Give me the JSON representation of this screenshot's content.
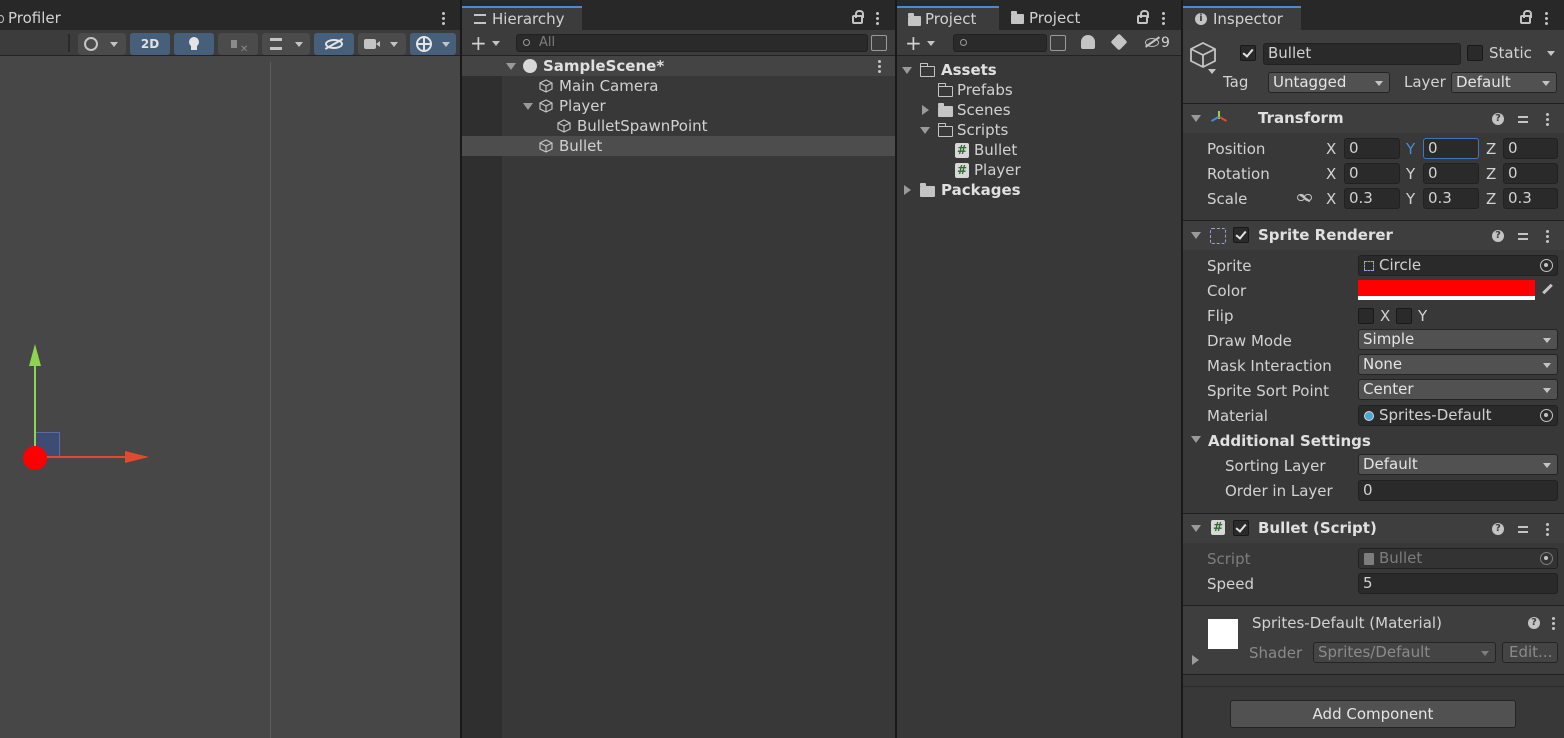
{
  "scene_panel": {
    "tab_label": "Profiler",
    "toolbar": {
      "btn_2d": "2D"
    }
  },
  "hierarchy": {
    "tab_label": "Hierarchy",
    "search_placeholder": "All",
    "scene_name": "SampleScene*",
    "items": [
      {
        "label": "Main Camera"
      },
      {
        "label": "Player"
      },
      {
        "label": "BulletSpawnPoint"
      },
      {
        "label": "Bullet"
      }
    ]
  },
  "project": {
    "tab1_label": "Project",
    "tab2_label": "Project",
    "hidden_count": "9",
    "tree": {
      "assets": "Assets",
      "prefabs": "Prefabs",
      "scenes": "Scenes",
      "scripts": "Scripts",
      "bullet_script": "Bullet",
      "player_script": "Player",
      "packages": "Packages"
    }
  },
  "inspector": {
    "tab_label": "Inspector",
    "object_name": "Bullet",
    "static_label": "Static",
    "tag_label": "Tag",
    "tag_value": "Untagged",
    "layer_label": "Layer",
    "layer_value": "Default",
    "transform": {
      "title": "Transform",
      "position_label": "Position",
      "rotation_label": "Rotation",
      "scale_label": "Scale",
      "axis_x": "X",
      "axis_y": "Y",
      "axis_z": "Z",
      "position": {
        "x": "0",
        "y": "0",
        "z": "0"
      },
      "rotation": {
        "x": "0",
        "y": "0",
        "z": "0"
      },
      "scale": {
        "x": "0.3",
        "y": "0.3",
        "z": "0.3"
      }
    },
    "sprite_renderer": {
      "title": "Sprite Renderer",
      "sprite_label": "Sprite",
      "sprite_value": "Circle",
      "color_label": "Color",
      "color_value": "#ff0000",
      "flip_label": "Flip",
      "flip_x": "X",
      "flip_y": "Y",
      "draw_mode_label": "Draw Mode",
      "draw_mode_value": "Simple",
      "mask_label": "Mask Interaction",
      "mask_value": "None",
      "sort_point_label": "Sprite Sort Point",
      "sort_point_value": "Center",
      "material_label": "Material",
      "material_value": "Sprites-Default",
      "additional_settings": "Additional Settings",
      "sorting_layer_label": "Sorting Layer",
      "sorting_layer_value": "Default",
      "order_label": "Order in Layer",
      "order_value": "0"
    },
    "bullet_script": {
      "title": "Bullet (Script)",
      "script_label": "Script",
      "script_value": "Bullet",
      "speed_label": "Speed",
      "speed_value": "5"
    },
    "material": {
      "title": "Sprites-Default (Material)",
      "shader_label": "Shader",
      "shader_value": "Sprites/Default",
      "edit_label": "Edit..."
    },
    "add_component": "Add Component"
  },
  "colors": {
    "accent": "#4a8ad8",
    "sprite_color": "#ff0000"
  }
}
